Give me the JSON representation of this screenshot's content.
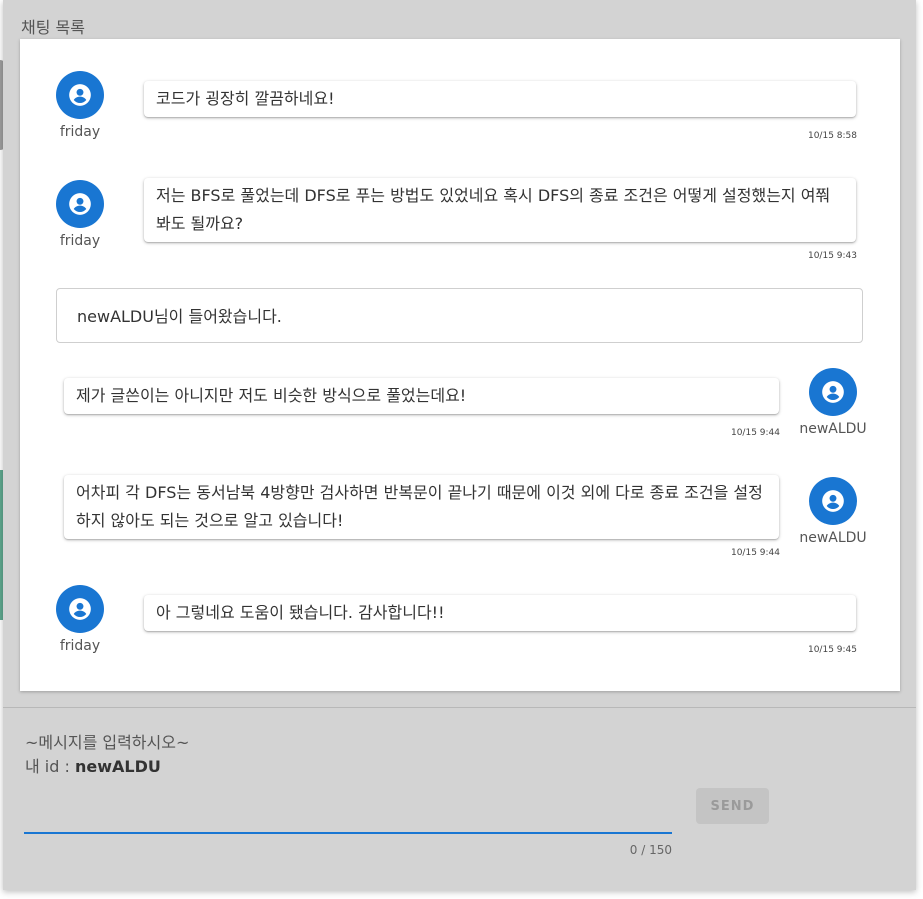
{
  "header": {
    "title": "채팅 목록"
  },
  "messages": [
    {
      "author": "friday",
      "text": "코드가 굉장히 깔끔하네요!",
      "time": "10/15 8:58"
    },
    {
      "author": "friday",
      "text": "저는 BFS로 풀었는데 DFS로 푸는 방법도 있었네요 혹시 DFS의 종료 조건은 어떻게 설정했는지 여쭤봐도 될까요?",
      "time": "10/15 9:43"
    },
    {
      "system": "newALDU님이 들어왔습니다."
    },
    {
      "author": "newALDU",
      "text": "제가 글쓴이는 아니지만 저도 비슷한 방식으로 풀었는데요!",
      "time": "10/15 9:44"
    },
    {
      "author": "newALDU",
      "text": "어차피 각 DFS는 동서남북 4방향만 검사하면 반복문이 끝나기 때문에 이것 외에 다로 종료 조건을 설정하지 않아도 되는 것으로 알고 있습니다!",
      "time": "10/15 9:44"
    },
    {
      "author": "friday",
      "text": "아 그렇네요 도움이 됐습니다. 감사합니다!!",
      "time": "10/15 9:45"
    }
  ],
  "composer": {
    "hint": "~메시지를 입력하시오~",
    "my_id_label": "내 id : ",
    "my_id": "newALDU",
    "value": "",
    "counter": "0 / 150",
    "send_label": "SEND"
  },
  "icons": {
    "avatar": "account-circle-icon"
  },
  "colors": {
    "accent": "#1976d2",
    "card_bg": "#d3d3d3"
  }
}
